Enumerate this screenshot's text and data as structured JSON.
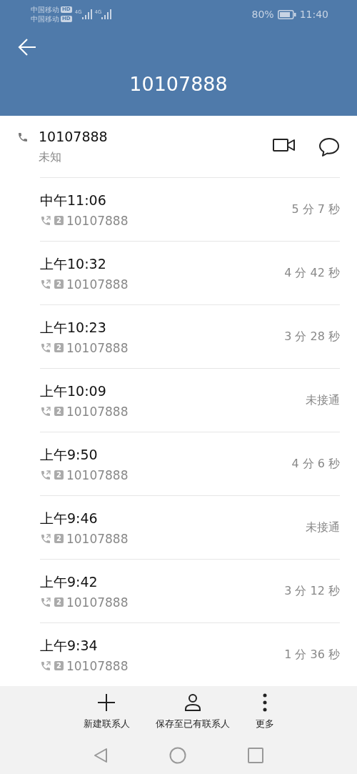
{
  "status_bar": {
    "carriers": [
      {
        "name": "中国移动",
        "badge": "HD",
        "network": "4G"
      },
      {
        "name": "中国移动",
        "badge": "HD",
        "network": "4G"
      }
    ],
    "battery": "80%",
    "time": "11:40"
  },
  "header": {
    "title": "10107888"
  },
  "contact": {
    "number": "10107888",
    "label": "未知"
  },
  "calls": [
    {
      "time": "中午11:06",
      "sim": "2",
      "number": "10107888",
      "duration": "5 分 7 秒"
    },
    {
      "time": "上午10:32",
      "sim": "2",
      "number": "10107888",
      "duration": "4 分 42 秒"
    },
    {
      "time": "上午10:23",
      "sim": "2",
      "number": "10107888",
      "duration": "3 分 28 秒"
    },
    {
      "time": "上午10:09",
      "sim": "2",
      "number": "10107888",
      "duration": "未接通"
    },
    {
      "time": "上午9:50",
      "sim": "2",
      "number": "10107888",
      "duration": "4 分 6 秒"
    },
    {
      "time": "上午9:46",
      "sim": "2",
      "number": "10107888",
      "duration": "未接通"
    },
    {
      "time": "上午9:42",
      "sim": "2",
      "number": "10107888",
      "duration": "3 分 12 秒"
    },
    {
      "time": "上午9:34",
      "sim": "2",
      "number": "10107888",
      "duration": "1 分 36 秒"
    }
  ],
  "actions": [
    {
      "kind": "add",
      "label": "新建联系人"
    },
    {
      "kind": "person",
      "label": "保存至已有联系人"
    },
    {
      "kind": "more",
      "label": "更多"
    }
  ]
}
